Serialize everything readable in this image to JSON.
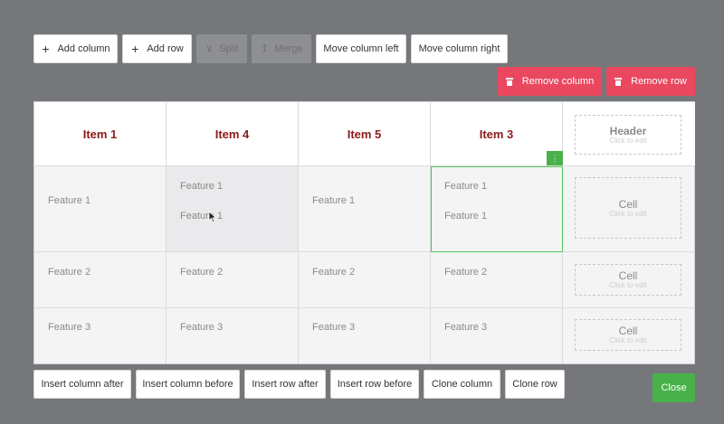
{
  "toolbar": {
    "add_column": "Add column",
    "add_row": "Add row",
    "split": "Split",
    "merge": "Merge",
    "move_left": "Move column left",
    "move_right": "Move column right",
    "remove_column": "Remove column",
    "remove_row": "Remove row"
  },
  "headers": [
    "Item 1",
    "Item 4",
    "Item 5",
    "Item 3"
  ],
  "extra_header": {
    "title": "Header",
    "hint": "Click to edit"
  },
  "rows": [
    {
      "cells": [
        [
          "Feature 1"
        ],
        [
          "Feature 1",
          "Feature 1"
        ],
        [
          "Feature 1"
        ],
        [
          "Feature 1",
          "Feature 1"
        ]
      ]
    },
    {
      "cells": [
        [
          "Feature 2"
        ],
        [
          "Feature 2"
        ],
        [
          "Feature 2"
        ],
        [
          "Feature 2"
        ]
      ]
    },
    {
      "cells": [
        [
          "Feature 3"
        ],
        [
          "Feature 3"
        ],
        [
          "Feature 3"
        ],
        [
          "Feature 3"
        ]
      ]
    }
  ],
  "extra_cell": {
    "title": "Cell",
    "hint": "Click to edit"
  },
  "bottom": {
    "insert_col_after": "Insert column after",
    "insert_col_before": "Insert column before",
    "insert_row_after": "Insert row after",
    "insert_row_before": "Insert row before",
    "clone_column": "Clone column",
    "clone_row": "Clone row",
    "close": "Close"
  },
  "colors": {
    "danger": "#e9485f",
    "success": "#48b14a",
    "header_text": "#8c1a1a",
    "overlay": "#76777a"
  },
  "icons": [
    "plus-icon",
    "split-icon",
    "merge-icon",
    "trash-icon",
    "move-handle-icon",
    "cursor-icon"
  ]
}
